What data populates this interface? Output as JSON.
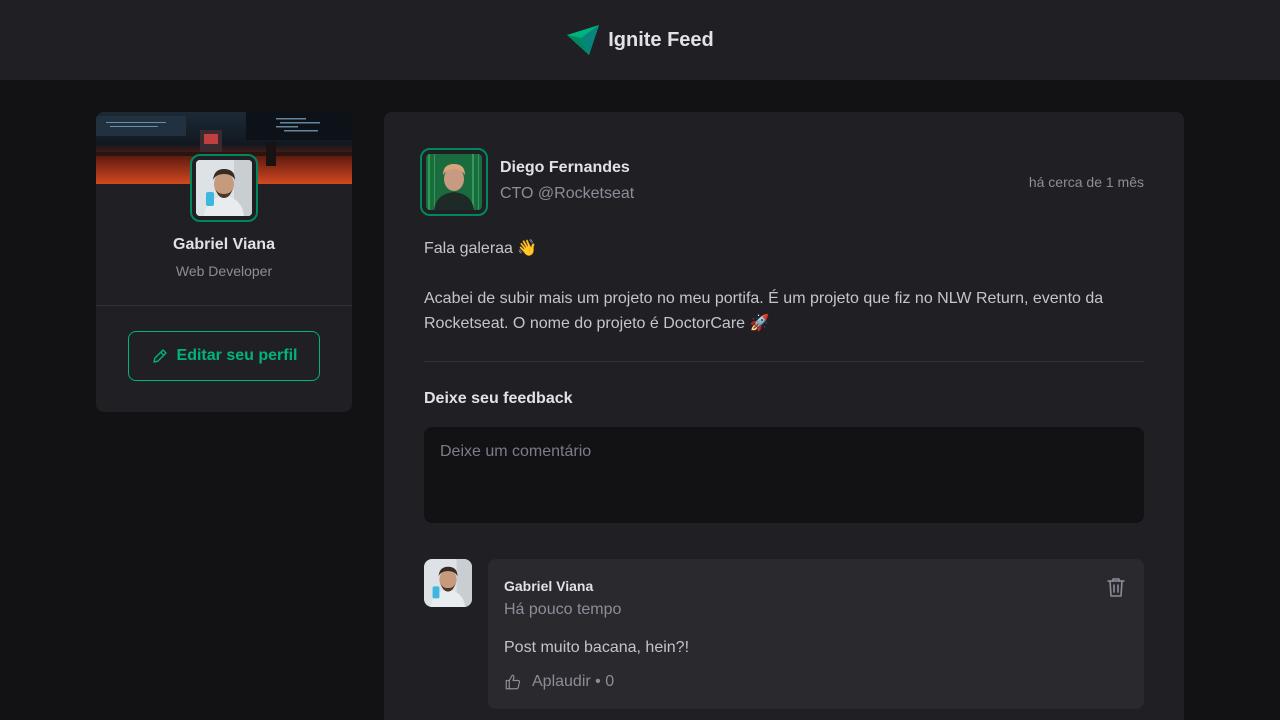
{
  "header": {
    "app_name": "Ignite Feed"
  },
  "sidebar": {
    "name": "Gabriel Viana",
    "role": "Web Developer",
    "edit_label": "Editar seu perfil"
  },
  "post": {
    "author_name": "Diego Fernandes",
    "author_role": "CTO @Rocketseat",
    "published": "há cerca de 1 mês",
    "paragraphs": [
      "Fala galeraa 👋",
      "Acabei de subir mais um projeto no meu portifa. É um projeto que fiz no NLW Return, evento da Rocketseat. O nome do projeto é DoctorCare 🚀"
    ],
    "feedback_title": "Deixe seu feedback",
    "comment_placeholder": "Deixe um comentário"
  },
  "comments": [
    {
      "author": "Gabriel Viana",
      "time": "Há pouco tempo",
      "text": "Post muito bacana, hein?!",
      "applaud_label": "Aplaudir",
      "applaud_count": "0",
      "applaud_display": "Aplaudir • 0"
    }
  ],
  "colors": {
    "accent": "#00b37e",
    "accent_dark": "#00875f",
    "background": "#121214",
    "card": "#202024"
  }
}
